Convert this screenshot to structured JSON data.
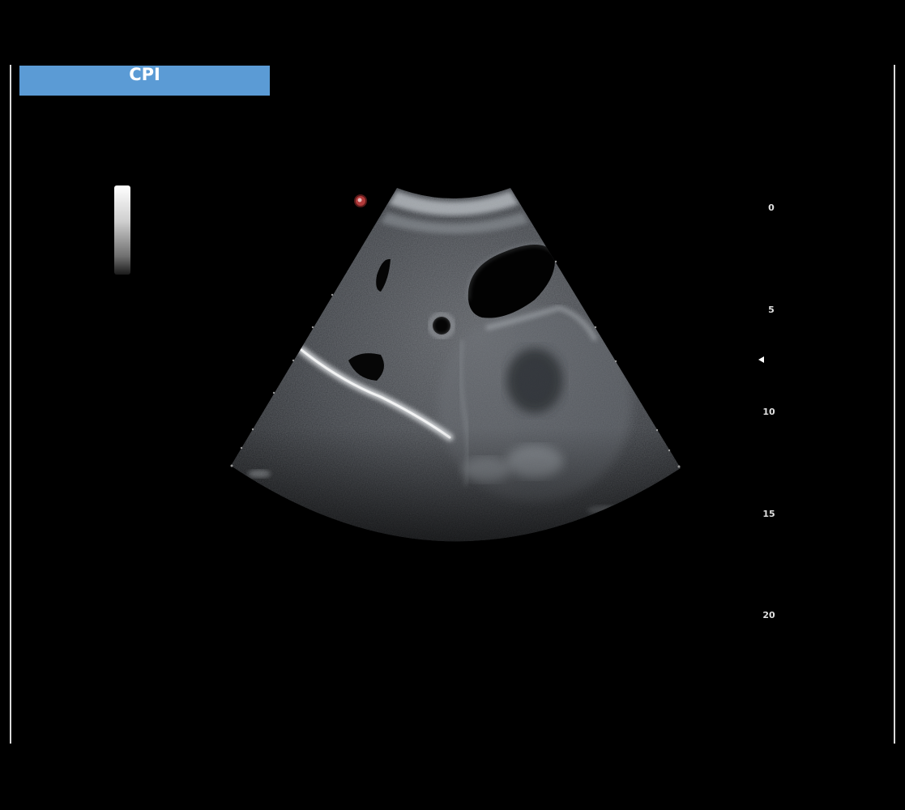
{
  "preset": {
    "label": "CPI",
    "color": "#5b9bd5"
  },
  "depth_scale": {
    "labels": [
      "0",
      "5",
      "10",
      "15",
      "20"
    ]
  },
  "probe_marker": {
    "icon": "probe-orientation-dot-icon",
    "color": "#c0392b"
  },
  "grayscale_bar": {
    "icon": "grayscale-map-bar"
  }
}
